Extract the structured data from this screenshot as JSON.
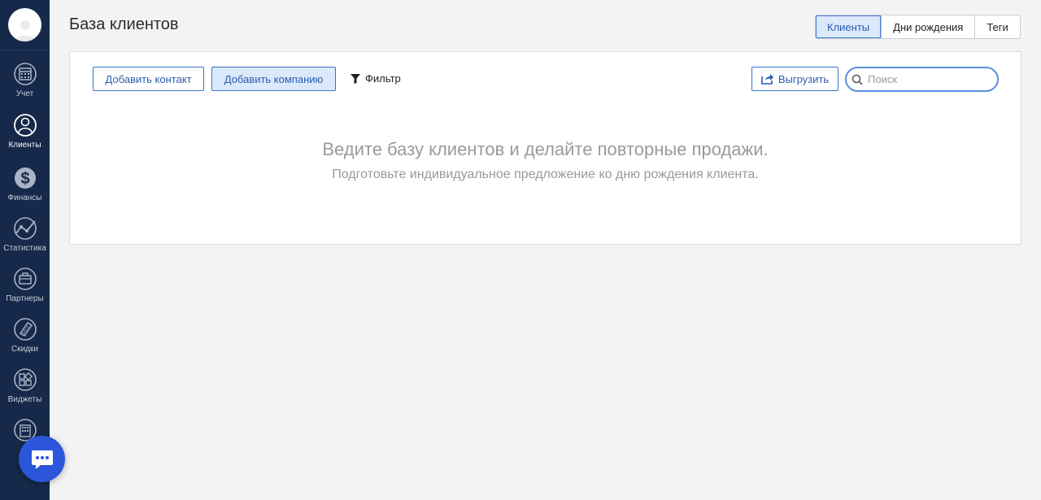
{
  "sidebar": {
    "items": [
      {
        "label": "Учет",
        "icon": "calendar-icon"
      },
      {
        "label": "Клиенты",
        "icon": "clients-icon"
      },
      {
        "label": "Финансы",
        "icon": "dollar-icon"
      },
      {
        "label": "Статистика",
        "icon": "chart-icon"
      },
      {
        "label": "Партнеры",
        "icon": "briefcase-icon"
      },
      {
        "label": "Скидки",
        "icon": "sale-tag-icon"
      },
      {
        "label": "Виджеты",
        "icon": "widgets-icon"
      }
    ],
    "active": "Клиенты"
  },
  "header": {
    "title": "База клиентов",
    "tabs": [
      {
        "label": "Клиенты",
        "active": true
      },
      {
        "label": "Дни рождения",
        "active": false
      },
      {
        "label": "Теги",
        "active": false
      }
    ]
  },
  "toolbar": {
    "add_contact": "Добавить контакт",
    "add_company": "Добавить компанию",
    "filter": "Фильтр",
    "export": "Выгрузить",
    "search_placeholder": "Поиск"
  },
  "empty_state": {
    "title": "Ведите базу клиентов и делайте повторные продажи.",
    "subtitle": "Подготовьте индивидуальное предложение ко дню рождения клиента."
  },
  "colors": {
    "sidebar": "#16294a",
    "accent": "#3b74c6",
    "chat_button": "#2b56d9"
  }
}
